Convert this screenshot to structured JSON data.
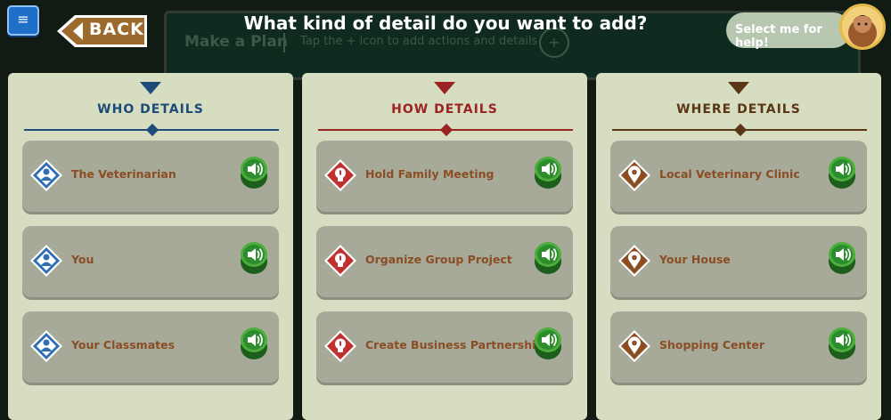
{
  "header": {
    "title": "What kind of detail do you want to add?",
    "back_label": "BACK",
    "menu_icon": "hamburger-menu-icon",
    "help_label": "Select me for help!"
  },
  "background_plan": {
    "title": "Make a Plan",
    "hint": "Tap the + icon to add actions and details",
    "plus": "+"
  },
  "colors": {
    "panel_bg": "#d7ddc1",
    "item_bg": "#a7a999",
    "item_text": "#8b4d23",
    "who": "#1d4b7a",
    "how": "#9b2323",
    "where": "#5a3616",
    "speaker_green": "#2d8c2d"
  },
  "panels": [
    {
      "title": "WHO DETAILS",
      "icon": "person-diamond-icon",
      "items": [
        {
          "label": "The Veterinarian"
        },
        {
          "label": "You"
        },
        {
          "label": "Your Classmates"
        }
      ]
    },
    {
      "title": "HOW DETAILS",
      "icon": "lightbulb-diamond-icon",
      "items": [
        {
          "label": "Hold Family Meeting"
        },
        {
          "label": "Organize Group Project"
        },
        {
          "label": "Create Business Partnership"
        }
      ]
    },
    {
      "title": "WHERE DETAILS",
      "icon": "location-pin-diamond-icon",
      "items": [
        {
          "label": "Local Veterinary Clinic"
        },
        {
          "label": "Your House"
        },
        {
          "label": "Shopping Center"
        }
      ]
    }
  ]
}
